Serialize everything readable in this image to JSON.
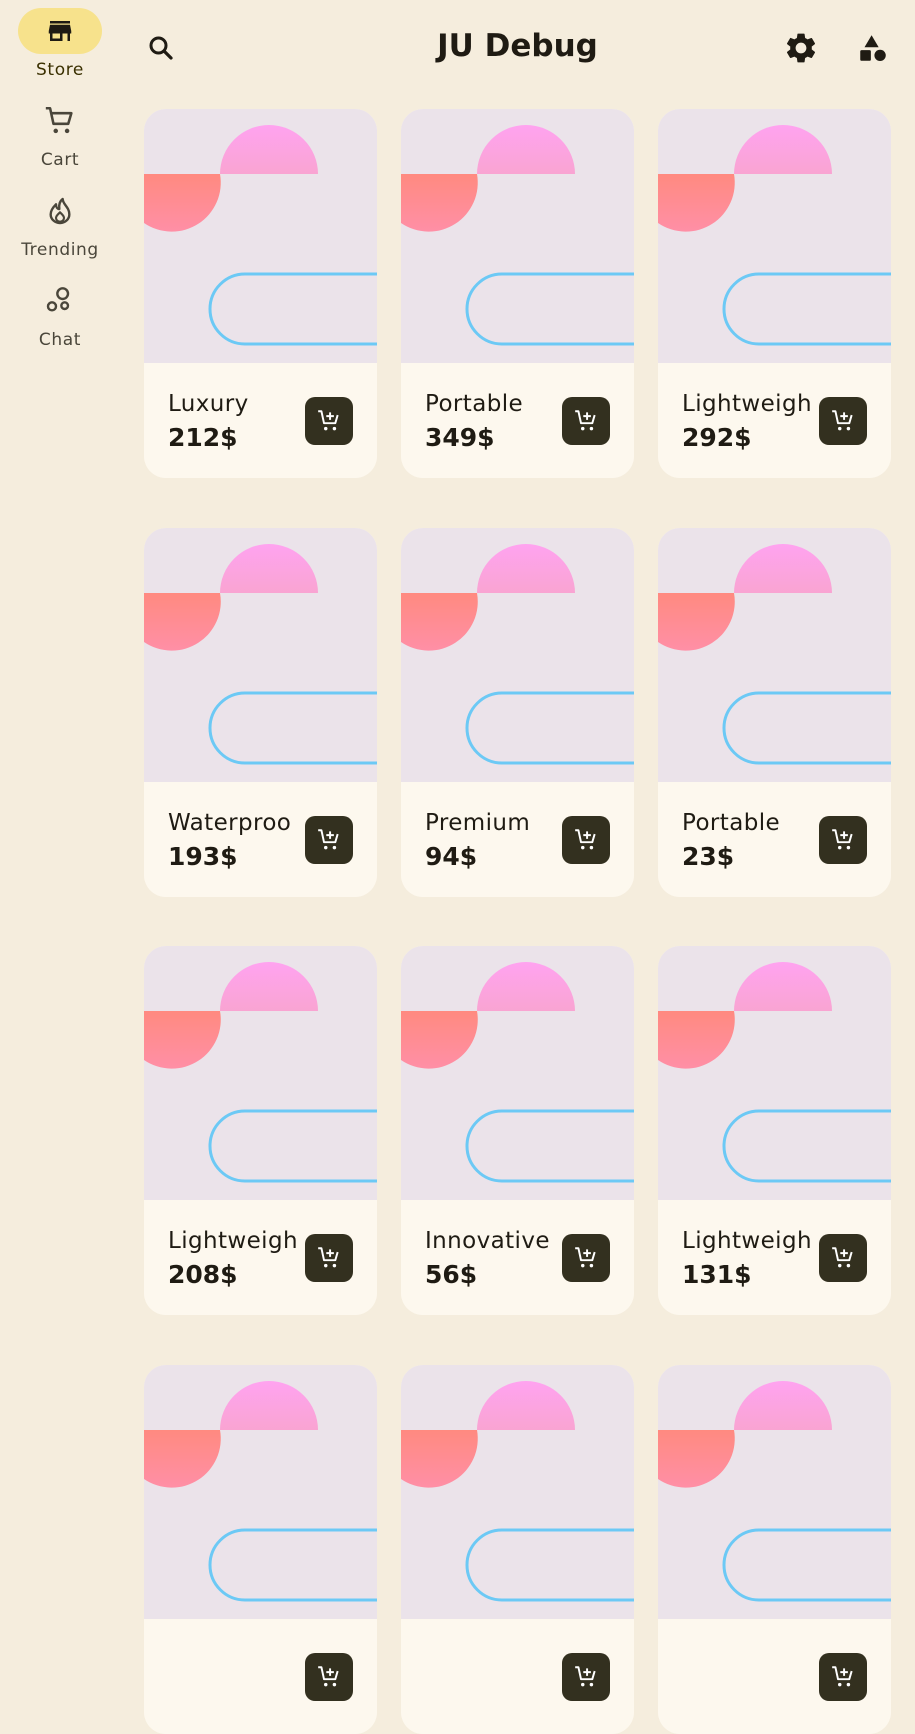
{
  "app": {
    "title": "JU Debug"
  },
  "nav": {
    "items": [
      {
        "label": "Store",
        "icon": "store-icon",
        "active": true
      },
      {
        "label": "Cart",
        "icon": "cart-icon",
        "active": false
      },
      {
        "label": "Trending",
        "icon": "trending-icon",
        "active": false
      },
      {
        "label": "Chat",
        "icon": "chat-icon",
        "active": false
      }
    ]
  },
  "toolbar": {
    "search_icon": "search-icon",
    "settings_icon": "gear-icon",
    "shapes_icon": "shapes-icon"
  },
  "colors": {
    "background": "#f5eddd",
    "rail_active": "#f7e28c",
    "card_art": "#ebe3ea",
    "card_info": "#fdf8ee",
    "cart_button": "#33301f",
    "shape_pink": "#fca6e6",
    "shape_coral": "#ff8a80",
    "outline_blue": "#6cc9f5"
  },
  "products": [
    {
      "name": "Luxury",
      "price": "212$"
    },
    {
      "name": "Portable",
      "price": "349$"
    },
    {
      "name": "Lightweigh",
      "price": "292$"
    },
    {
      "name": "Waterproo",
      "price": "193$"
    },
    {
      "name": "Premium",
      "price": "94$"
    },
    {
      "name": "Portable",
      "price": "23$"
    },
    {
      "name": "Lightweigh",
      "price": "208$"
    },
    {
      "name": "Innovative",
      "price": "56$"
    },
    {
      "name": "Lightweigh",
      "price": "131$"
    },
    {
      "name": "",
      "price": ""
    },
    {
      "name": "",
      "price": ""
    },
    {
      "name": "",
      "price": ""
    }
  ]
}
